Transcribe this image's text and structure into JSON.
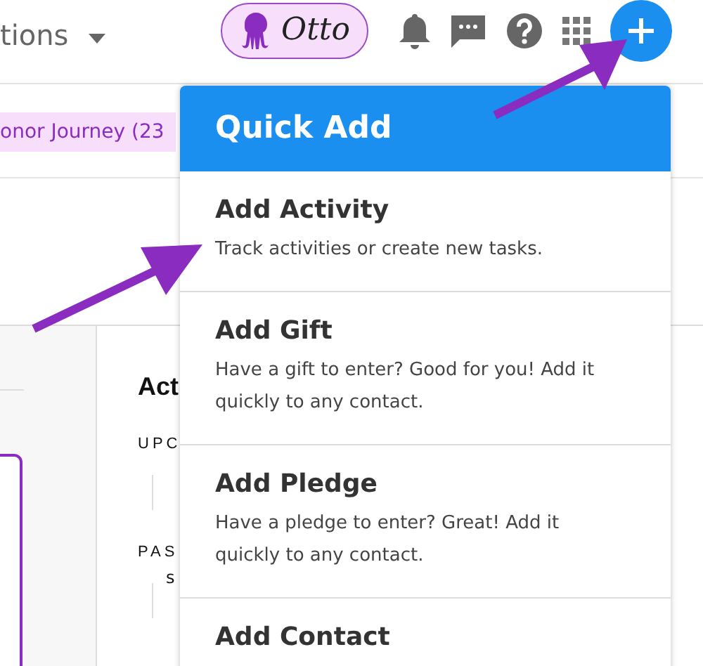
{
  "topbar": {
    "nav_label": "tions",
    "assistant": {
      "name": "Otto"
    }
  },
  "filter_tag": {
    "label": "onor Journey (23"
  },
  "activity_panel": {
    "title": "Act",
    "sections": [
      "UPC",
      "PAS"
    ],
    "fragment": "s"
  },
  "quick_add": {
    "title": "Quick Add",
    "items": [
      {
        "title": "Add Activity",
        "description": "Track activities or create new tasks."
      },
      {
        "title": "Add Gift",
        "description": "Have a gift to enter? Good for you! Add it quickly to any contact."
      },
      {
        "title": "Add Pledge",
        "description": "Have a pledge to enter? Great! Add it quickly to any contact."
      },
      {
        "title": "Add Contact"
      }
    ]
  }
}
